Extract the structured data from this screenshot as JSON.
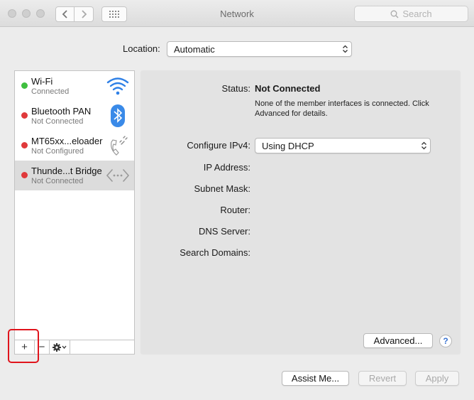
{
  "window": {
    "title": "Network"
  },
  "search": {
    "placeholder": "Search"
  },
  "location": {
    "label": "Location:",
    "value": "Automatic"
  },
  "services": [
    {
      "name": "Wi-Fi",
      "status": "Connected",
      "dot_color": "#3fbf3f",
      "icon": "wifi-icon"
    },
    {
      "name": "Bluetooth PAN",
      "status": "Not Connected",
      "dot_color": "#e0393b",
      "icon": "bluetooth-icon"
    },
    {
      "name": "MT65xx...eloader",
      "status": "Not Configured",
      "dot_color": "#e0393b",
      "icon": "phone-icon"
    },
    {
      "name": "Thunde...t Bridge",
      "status": "Not Connected",
      "dot_color": "#e0393b",
      "icon": "bridge-icon",
      "selected": true
    }
  ],
  "sidebar_buttons": {
    "add": "+",
    "remove": "−"
  },
  "detail": {
    "status_label": "Status:",
    "status_value": "Not Connected",
    "status_description": "None of the member interfaces is connected. Click Advanced for details.",
    "configure_label": "Configure IPv4:",
    "configure_value": "Using DHCP",
    "ip_label": "IP Address:",
    "subnet_label": "Subnet Mask:",
    "router_label": "Router:",
    "dns_label": "DNS Server:",
    "search_domains_label": "Search Domains:",
    "advanced_label": "Advanced...",
    "help_label": "?"
  },
  "footer": {
    "assist_label": "Assist Me...",
    "revert_label": "Revert",
    "apply_label": "Apply"
  },
  "colors": {
    "highlight": "#e0141c",
    "accent": "#3a73d1"
  }
}
